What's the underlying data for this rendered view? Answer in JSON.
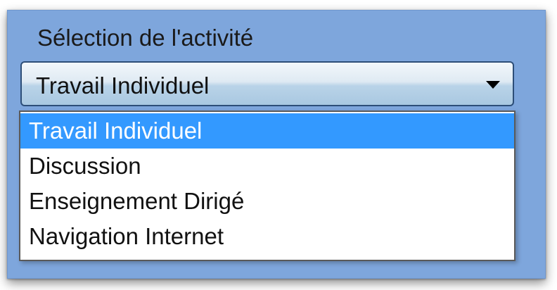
{
  "group": {
    "title": "Sélection de l'activité"
  },
  "combo": {
    "selected": "Travail Individuel",
    "arrow_icon": "triangle-down-icon"
  },
  "dropdown": {
    "options": [
      {
        "label": "Travail Individuel",
        "selected": true
      },
      {
        "label": "Discussion",
        "selected": false
      },
      {
        "label": "Enseignement Dirigé",
        "selected": false
      },
      {
        "label": "Navigation Internet",
        "selected": false
      }
    ]
  },
  "colors": {
    "panel_background": "#7ea6dc",
    "selection_highlight": "#3399ff",
    "combo_border": "#2d4e78"
  }
}
